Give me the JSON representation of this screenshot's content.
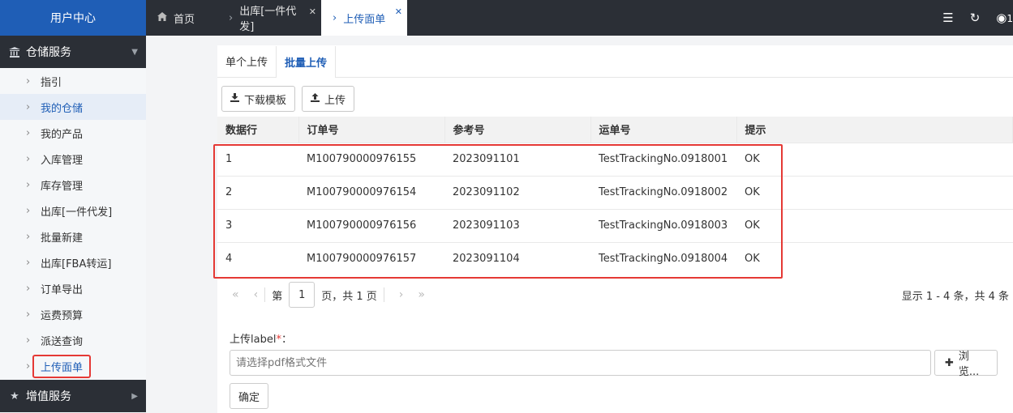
{
  "sidebar": {
    "brand": "用户中心",
    "group1": "仓储服务",
    "items": [
      {
        "label": "指引"
      },
      {
        "label": "我的仓储"
      },
      {
        "label": "我的产品"
      },
      {
        "label": "入库管理"
      },
      {
        "label": "库存管理"
      },
      {
        "label": "出库[一件代发]"
      },
      {
        "label": "批量新建"
      },
      {
        "label": "出库[FBA转运]"
      },
      {
        "label": "订单导出"
      },
      {
        "label": "运费预算"
      },
      {
        "label": "派送查询"
      },
      {
        "label": "上传面单"
      }
    ],
    "group2": "增值服务"
  },
  "topbar": {
    "home": "首页",
    "tab1": "出库[一件代发]",
    "tab2": "上传面单",
    "tools_extra": "1"
  },
  "subtabs": {
    "single": "单个上传",
    "batch": "批量上传"
  },
  "toolbar": {
    "download": "下载模板",
    "upload": "上传"
  },
  "table": {
    "headers": [
      "数据行",
      "订单号",
      "参考号",
      "运单号",
      "提示"
    ],
    "rows": [
      [
        "1",
        "M100790000976155",
        "2023091101",
        "TestTrackingNo.0918001",
        "OK"
      ],
      [
        "2",
        "M100790000976154",
        "2023091102",
        "TestTrackingNo.0918002",
        "OK"
      ],
      [
        "3",
        "M100790000976156",
        "2023091103",
        "TestTrackingNo.0918003",
        "OK"
      ],
      [
        "4",
        "M100790000976157",
        "2023091104",
        "TestTrackingNo.0918004",
        "OK"
      ]
    ]
  },
  "pager": {
    "prefix": "第",
    "page": "1",
    "suffix": "页，共 1 页",
    "summary": "显示 1 - 4 条，共 4 条"
  },
  "upload": {
    "label": "上传label",
    "required": "*",
    "colon": "：",
    "placeholder": "请选择pdf格式文件",
    "browse": "浏览...",
    "confirm": "确定"
  },
  "colors": {
    "primary": "#1f5eb6",
    "dark": "#2b2f36",
    "highlight": "#e53935"
  }
}
